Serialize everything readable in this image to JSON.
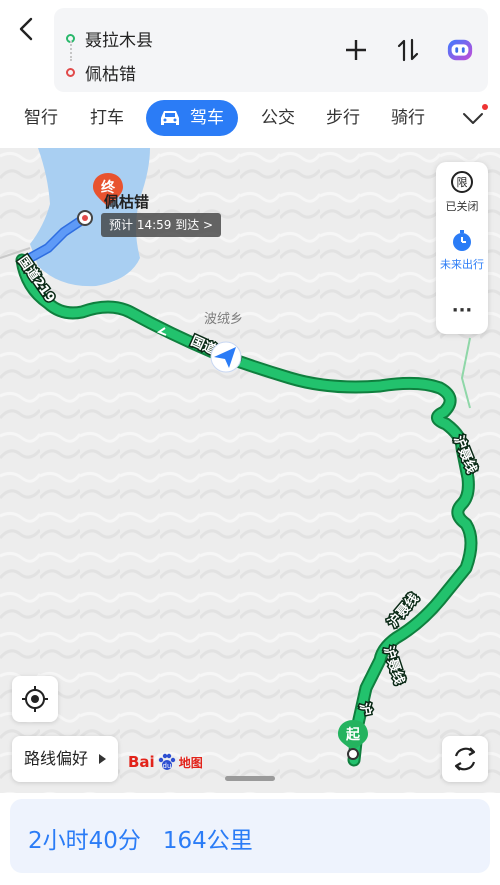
{
  "route": {
    "origin": "聂拉木县",
    "destination": "佩枯错"
  },
  "modes": {
    "smart": "智行",
    "taxi": "打车",
    "drive": "驾车",
    "bus": "公交",
    "walk": "步行",
    "ride": "骑行"
  },
  "map": {
    "poi": "波绒乡",
    "dest_label": "佩枯错",
    "eta": "预计 14:59 到达 >",
    "end_marker": "终",
    "start_marker": "起",
    "road_labels": {
      "g219_a": "国道219",
      "g219_b": "国道219",
      "hunie_1": "沪聂线",
      "hunie_2": "沪聂线",
      "hunie_3": "沪聂线",
      "hunie_4": "沪"
    }
  },
  "controls": {
    "limit_icon_text": "限",
    "limit_label": "已关闭",
    "future_label": "未来出行",
    "more_label": "···",
    "route_pref": "路线偏好"
  },
  "logo": {
    "part1": "Bai",
    "part2": "du",
    "part3": "地图"
  },
  "summary": {
    "duration": "2小时40分",
    "distance": "164公里"
  },
  "colors": {
    "accent": "#2b7cf6",
    "route_green": "#1fc06a",
    "route_blue": "#4d8ef5",
    "start": "#29b86b",
    "end": "#e8532f"
  }
}
